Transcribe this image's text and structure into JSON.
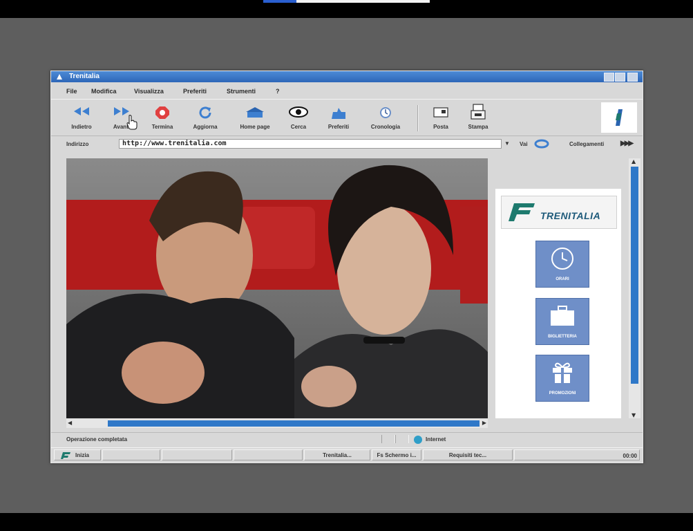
{
  "window": {
    "title": "Trenitalia"
  },
  "menu": [
    "File",
    "Modifica",
    "Visualizza",
    "Preferiti",
    "Strumenti",
    "?"
  ],
  "toolbar": {
    "back": "Indietro",
    "forward": "Avanti",
    "stop": "Termina",
    "refresh": "Aggiorna",
    "home": "Home page",
    "search": "Cerca",
    "favorites": "Preferiti",
    "history": "Cronologia",
    "mail": "Posta",
    "print": "Stampa"
  },
  "address": {
    "label": "Indirizzo",
    "value": "http://www.trenitalia.com",
    "go": "Vai",
    "links": "Collegamenti"
  },
  "sidepanel": {
    "logo": "TRENITALIA",
    "buttons": [
      "ORARI",
      "BIGLIETTERIA",
      "PROMOZIONI"
    ]
  },
  "status": {
    "text": "Operazione completata",
    "zone": "Internet"
  },
  "taskbar": {
    "start": "Inizia",
    "tasks": [
      "Trenitalia...",
      "Fs Schermo i...",
      "Requisiti tec..."
    ],
    "clock": "00:00"
  },
  "colors": {
    "titlebar": "#2d66b8",
    "scroll_thumb": "#2f78c8",
    "side_button": "#6f8fc8",
    "brand_green": "#1e7a6e"
  }
}
